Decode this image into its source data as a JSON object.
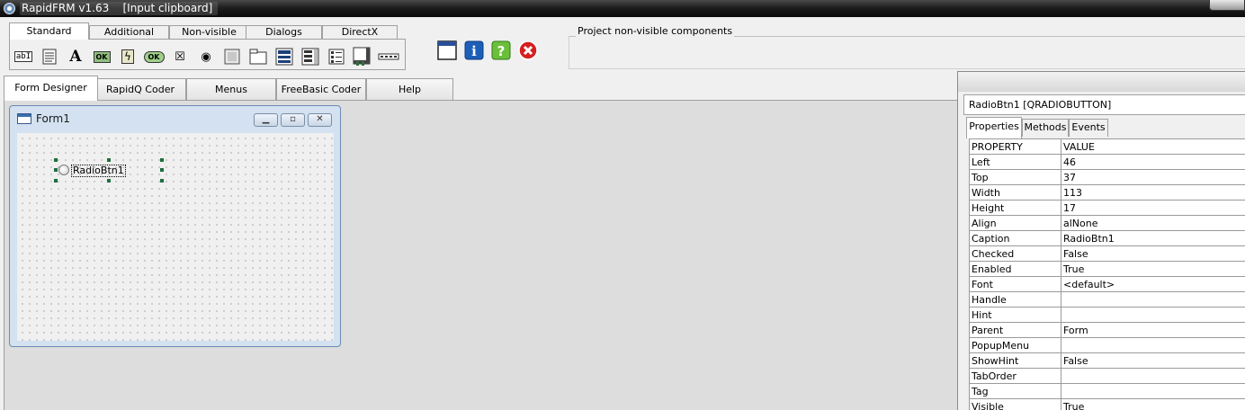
{
  "window": {
    "title": "RapidFRM v1.63    [Input clipboard]"
  },
  "palette": {
    "tabs": [
      "Standard",
      "Additional",
      "Non-visible",
      "Dialogs",
      "DirectX"
    ],
    "active_tab": "Standard",
    "tools": [
      {
        "icon": "edit-tool-icon",
        "glyph": "abI"
      },
      {
        "icon": "memo-tool-icon",
        "glyph": "≣"
      },
      {
        "icon": "label-tool-icon",
        "glyph": "A"
      },
      {
        "icon": "button-tool-icon",
        "glyph": "OK"
      },
      {
        "icon": "bitbutton-tool-icon",
        "glyph": "ϟ"
      },
      {
        "icon": "coolbutton-tool-icon",
        "glyph": "OK"
      },
      {
        "icon": "checkbox-tool-icon",
        "glyph": "☒"
      },
      {
        "icon": "radiobutton-tool-icon",
        "glyph": "◉"
      },
      {
        "icon": "panel-tool-icon",
        "glyph": ""
      },
      {
        "icon": "groupbox-tool-icon",
        "glyph": ""
      },
      {
        "icon": "combobox-tool-icon",
        "glyph": ""
      },
      {
        "icon": "listbox-tool-icon",
        "glyph": ""
      },
      {
        "icon": "checklist-tool-icon",
        "glyph": ""
      },
      {
        "icon": "scrollbox-tool-icon",
        "glyph": ""
      },
      {
        "icon": "statusbar-tool-icon",
        "glyph": ""
      }
    ]
  },
  "toolbar": {
    "icons": [
      "form-window-icon",
      "info-icon",
      "help-icon",
      "close-icon"
    ]
  },
  "nonvisible": {
    "label": "Project non-visible components"
  },
  "main_tabs": [
    "Form Designer",
    "RapidQ Coder",
    "Menus",
    "FreeBasic Coder",
    "Help"
  ],
  "form": {
    "title": "Form1",
    "controls": {
      "radio_caption": "RadioBtn1"
    }
  },
  "inspector": {
    "component": "RadioBtn1 [QRADIOBUTTON]",
    "tabs": [
      "Properties",
      "Methods",
      "Events"
    ],
    "columns": [
      "PROPERTY",
      "VALUE"
    ],
    "rows": [
      {
        "name": "Left",
        "value": "46"
      },
      {
        "name": "Top",
        "value": "37"
      },
      {
        "name": "Width",
        "value": "113"
      },
      {
        "name": "Height",
        "value": "17"
      },
      {
        "name": "Align",
        "value": "alNone"
      },
      {
        "name": "Caption",
        "value": "RadioBtn1"
      },
      {
        "name": "Checked",
        "value": "False"
      },
      {
        "name": "Enabled",
        "value": "True"
      },
      {
        "name": "Font",
        "value": "<default>"
      },
      {
        "name": "Handle",
        "value": ""
      },
      {
        "name": "Hint",
        "value": ""
      },
      {
        "name": "Parent",
        "value": "Form"
      },
      {
        "name": "PopupMenu",
        "value": ""
      },
      {
        "name": "ShowHint",
        "value": "False"
      },
      {
        "name": "TabOrder",
        "value": ""
      },
      {
        "name": "Tag",
        "value": ""
      },
      {
        "name": "Visible",
        "value": "True"
      }
    ]
  }
}
